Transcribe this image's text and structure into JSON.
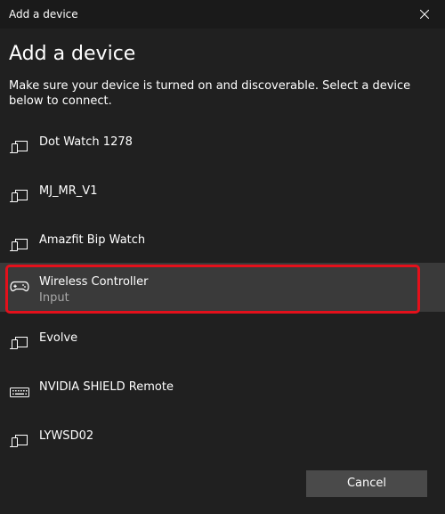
{
  "window": {
    "title": "Add a device"
  },
  "main": {
    "heading": "Add a device",
    "description": "Make sure your device is turned on and discoverable. Select a device below to connect."
  },
  "devices": [
    {
      "name": "Dot Watch 1278",
      "icon": "device-pc-phone-icon"
    },
    {
      "name": "MJ_MR_V1",
      "icon": "device-pc-phone-icon"
    },
    {
      "name": "Amazfit Bip Watch",
      "icon": "device-pc-phone-icon"
    },
    {
      "name": "Wireless Controller",
      "subtitle": "Input",
      "icon": "gamepad-icon",
      "selected": true
    },
    {
      "name": "Evolve",
      "icon": "device-pc-phone-icon"
    },
    {
      "name": "NVIDIA SHIELD Remote",
      "icon": "keyboard-icon"
    },
    {
      "name": "LYWSD02",
      "icon": "device-pc-phone-icon"
    }
  ],
  "footer": {
    "cancel_label": "Cancel"
  },
  "colors": {
    "background": "#202020",
    "selected_row": "#3a3a3a",
    "highlight": "#e4101b",
    "button": "#4a4a4a",
    "subtitle_text": "#a8a8a8"
  }
}
